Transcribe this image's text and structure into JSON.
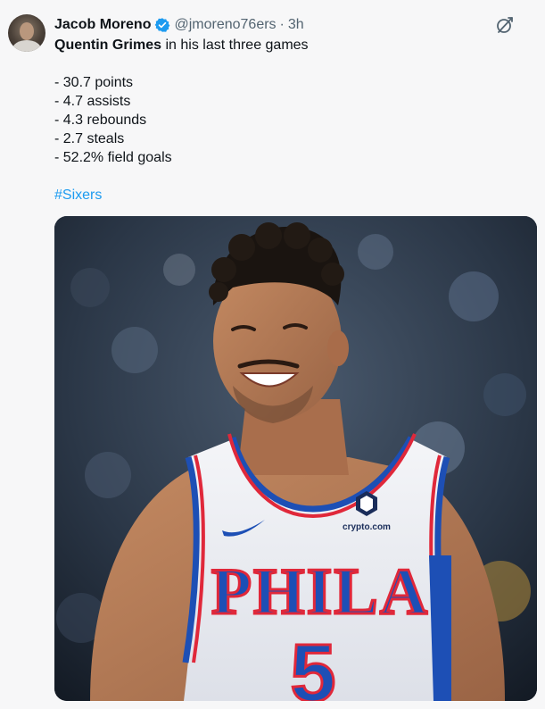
{
  "tweet": {
    "author": {
      "display_name": "Jacob Moreno",
      "handle": "@jmoreno76ers",
      "separator": "·",
      "time": "3h",
      "verified_icon": "verified-badge-icon"
    },
    "actions": {
      "grok_icon": "grok-icon"
    },
    "body": {
      "mention": "Quentin Grimes",
      "intro_rest": " in his last three games",
      "stats": [
        "- 30.7 points",
        "- 4.7 assists",
        "- 4.3 rebounds",
        "- 2.7 steals",
        "- 52.2% field goals"
      ],
      "hashtag": "#Sixers"
    },
    "media": {
      "jersey_wordmark": "PHILA",
      "jersey_number": "5",
      "jersey_sponsor": "crypto.com"
    },
    "colors": {
      "link": "#1d9bf0",
      "verified": "#1d9bf0",
      "jersey_blue": "#1d4fb5",
      "jersey_red": "#e0283a"
    }
  }
}
